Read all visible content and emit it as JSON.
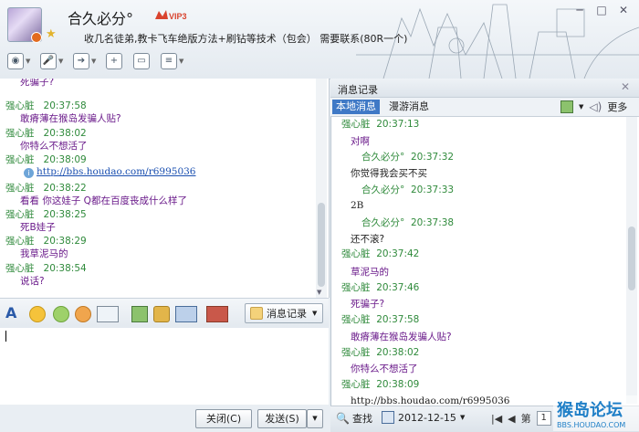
{
  "header": {
    "name": "合久必分°",
    "vip": "VIP3",
    "signature": "收几名徒弟,教卡飞车绝版方法+刷钻等技术（包会） 需要联系(80R一个)"
  },
  "toolbar": {
    "icons": [
      "video-call-icon",
      "voice-call-icon",
      "file-transfer-icon",
      "add-member-icon",
      "remote-desktop-icon",
      "apps-icon"
    ]
  },
  "chat": {
    "top_partial": "死骗子?",
    "messages": [
      {
        "sender": "强心脏",
        "time": "20:37:58",
        "text": "敢瘠薄在猴岛发骗人贴?"
      },
      {
        "sender": "强心脏",
        "time": "20:38:02",
        "text": "你特么不想活了"
      },
      {
        "sender": "强心脏",
        "time": "20:38:09",
        "link": "http://bbs.houdao.com/r6995036"
      },
      {
        "sender": "强心脏",
        "time": "20:38:22",
        "text": "看看 你这娃子 Q都在百度丧成什么样了"
      },
      {
        "sender": "强心脏",
        "time": "20:38:25",
        "text": "死B娃子"
      },
      {
        "sender": "强心脏",
        "time": "20:38:29",
        "text": "我草泥马的"
      },
      {
        "sender": "强心脏",
        "time": "20:38:54",
        "text": "说话?"
      }
    ]
  },
  "format_bar": {
    "history_label": "消息记录"
  },
  "buttons": {
    "close_label": "关闭(C)",
    "send_label": "发送(S)"
  },
  "history": {
    "title": "消息记录",
    "tab_local": "本地消息",
    "tab_roam": "漫游消息",
    "more_label": "更多",
    "entries": [
      {
        "sender": "强心脏",
        "time": "20:37:13",
        "text": "对啊",
        "self": false
      },
      {
        "sender": "合久必分°",
        "time": "20:37:32",
        "text": "你觉得我会买不买",
        "self": true
      },
      {
        "sender": "合久必分°",
        "time": "20:37:33",
        "text": "2B",
        "self": true
      },
      {
        "sender": "合久必分°",
        "time": "20:37:38",
        "text": "还不滚?",
        "self": true
      },
      {
        "sender": "强心脏",
        "time": "20:37:42",
        "text": "草泥马的",
        "self": false
      },
      {
        "sender": "强心脏",
        "time": "20:37:46",
        "text": "死骗子?",
        "self": false
      },
      {
        "sender": "强心脏",
        "time": "20:37:58",
        "text": "敢瘠薄在猴岛发骗人贴?",
        "self": false
      },
      {
        "sender": "强心脏",
        "time": "20:38:02",
        "text": "你特么不想活了",
        "self": false
      },
      {
        "sender": "强心脏",
        "time": "20:38:09",
        "text": "",
        "self": false
      }
    ],
    "tail_link": "http://bbs.houdao.com/r6995036",
    "find_label": "查找",
    "date": "2012-12-15",
    "page_prefix": "第",
    "page_value": "1"
  },
  "watermark": {
    "text": "猴岛论坛",
    "url": "BBS.HOUDAO.COM"
  }
}
